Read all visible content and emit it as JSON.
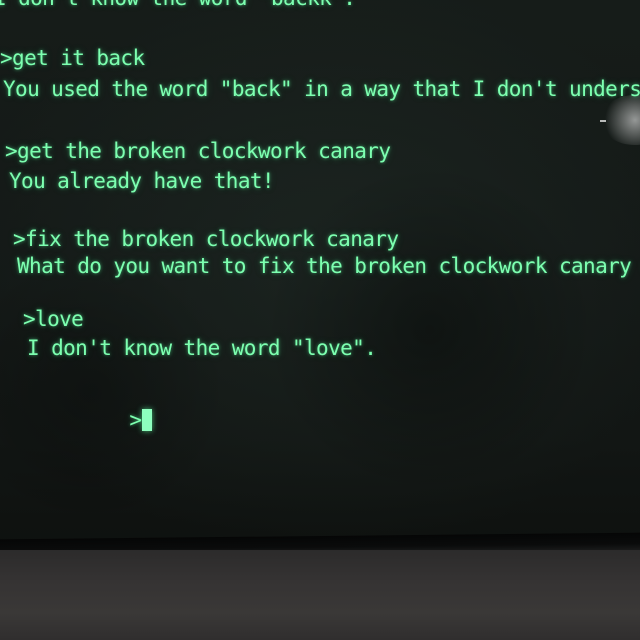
{
  "terminal": {
    "lines": [
      "I don't know the word \"backk\".",
      ">get it back",
      "You used the word \"back\" in a way that I don't understan",
      ">get the broken clockwork canary",
      "You already have that!",
      ">fix the broken clockwork canary",
      "What do you want to fix the broken clockwork canary with?",
      ">love",
      "I don't know the word \"love\".",
      ">"
    ]
  },
  "colors": {
    "phosphor": "#7dffb0",
    "screen": "#141917",
    "bezel": "#353333"
  }
}
